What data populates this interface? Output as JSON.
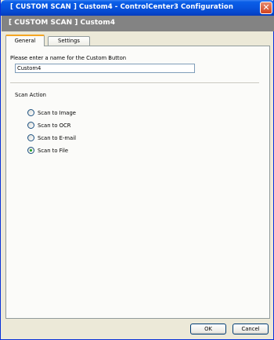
{
  "window": {
    "title": "[  CUSTOM SCAN  ]   Custom4 - ControlCenter3 Configuration",
    "close_glyph": "✕"
  },
  "banner": {
    "text": "[  CUSTOM SCAN  ]    Custom4"
  },
  "tabs": [
    {
      "label": "General",
      "active": true
    },
    {
      "label": "Settings",
      "active": false
    }
  ],
  "general": {
    "name_label": "Please enter a name for the Custom Button",
    "name_value": "Custom4",
    "scan_action_label": "Scan Action",
    "options": [
      {
        "label": "Scan to Image",
        "selected": false
      },
      {
        "label": "Scan to OCR",
        "selected": false
      },
      {
        "label": "Scan to E-mail",
        "selected": false
      },
      {
        "label": "Scan to File",
        "selected": true
      }
    ]
  },
  "buttons": {
    "ok": "OK",
    "cancel": "Cancel"
  },
  "colors": {
    "titlebar": "#0753DD",
    "banner": "#838383",
    "tab_accent": "#F5A623",
    "radio_selected": "#21A121"
  }
}
